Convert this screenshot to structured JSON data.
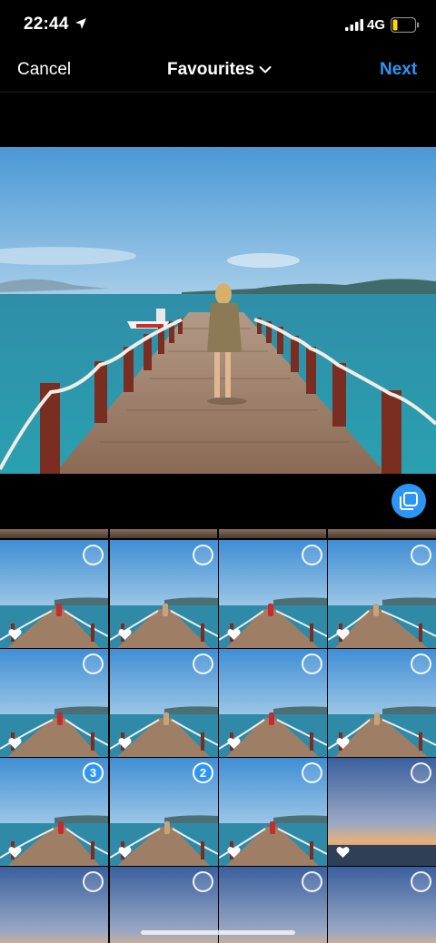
{
  "status": {
    "time": "22:44",
    "network": "4G",
    "icons": [
      "location-arrow-icon",
      "signal-icon",
      "battery-icon"
    ]
  },
  "nav": {
    "cancel_label": "Cancel",
    "title": "Favourites",
    "next_label": "Next",
    "next_color": "#2d96f5"
  },
  "multi_select_icon": "multi-select-icon",
  "grid": {
    "rows": [
      [
        {
          "type": "pier",
          "badge": ""
        },
        {
          "type": "pier",
          "badge": ""
        },
        {
          "type": "pier",
          "badge": ""
        },
        {
          "type": "pier",
          "badge": ""
        }
      ],
      [
        {
          "type": "pier",
          "badge": ""
        },
        {
          "type": "pier",
          "badge": ""
        },
        {
          "type": "pier",
          "badge": ""
        },
        {
          "type": "pier",
          "badge": ""
        }
      ],
      [
        {
          "type": "pier",
          "badge": "3"
        },
        {
          "type": "pier",
          "badge": "2"
        },
        {
          "type": "pier",
          "badge": ""
        },
        {
          "type": "sunset",
          "badge": ""
        }
      ],
      [
        {
          "type": "sunset",
          "badge": ""
        },
        {
          "type": "sunset",
          "badge": ""
        },
        {
          "type": "sunset",
          "badge": ""
        },
        {
          "type": "sunset",
          "badge": ""
        }
      ]
    ]
  }
}
